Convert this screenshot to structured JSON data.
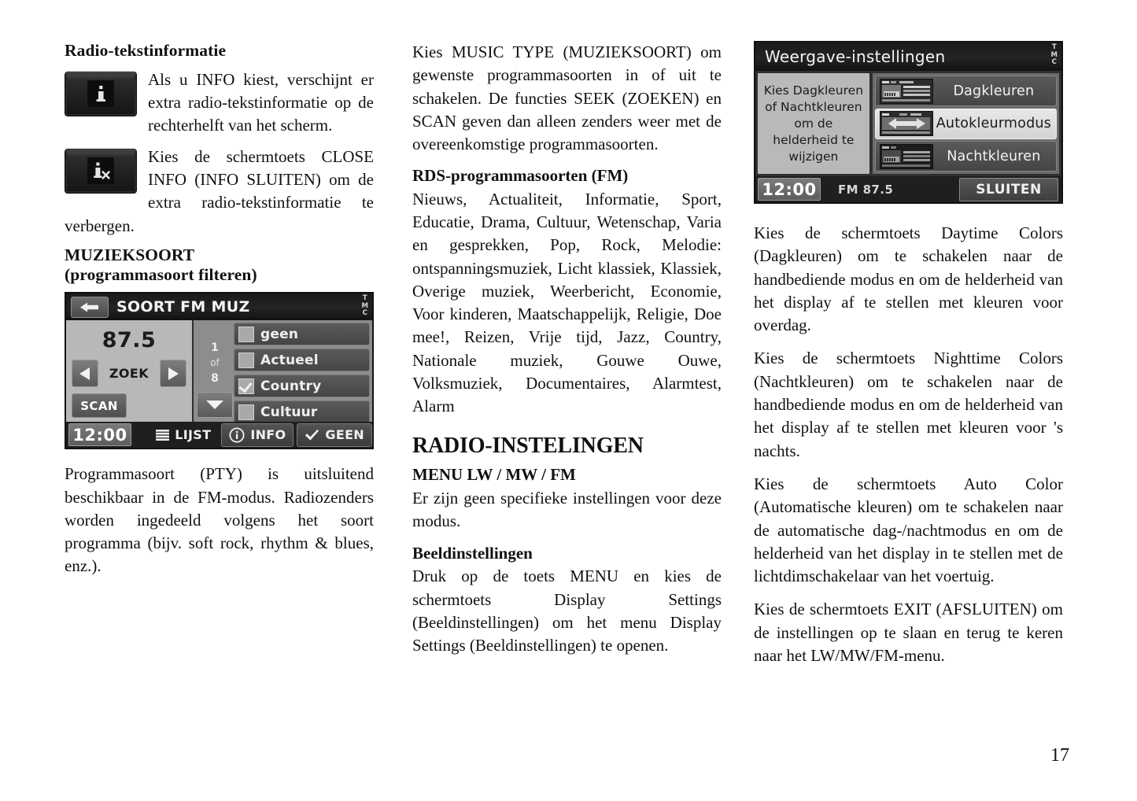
{
  "page": {
    "number": "17"
  },
  "left_column": {
    "heading_radiotext": "Radio-tekstinformatie",
    "para_info": "Als u INFO kiest, verschijnt er extra radio-tekstinformatie op de rechterhelft van het scherm.",
    "para_close_info": "Kies de schermtoets CLOSE INFO (INFO SLUITEN) om de extra radio-tekstinformatie te verbergen.",
    "icon_info_name": "info-icon",
    "icon_close_info_name": "close-info-icon",
    "heading_muzieksoort": "MUZIEKSOORT",
    "heading_muzieksoort_sub": "(programmasoort filteren)",
    "para_pty": "Programmasoort (PTY) is uitsluitend beschikbaar in de FM-modus. Radiozenders worden ingedeeld volgens het soort programma (bijv. soft rock, rhythm & blues, enz.)."
  },
  "display_pty": {
    "title": "SOORT FM MUZ",
    "tmc": [
      "T",
      "M",
      "C"
    ],
    "frequency": "87.5",
    "seek_label": "ZOEK",
    "scan_label": "SCAN",
    "pager": {
      "current": "1",
      "of": "of",
      "total": "8"
    },
    "list": [
      {
        "label": "geen",
        "checked": false
      },
      {
        "label": "Actueel",
        "checked": false
      },
      {
        "label": "Country",
        "checked": true
      },
      {
        "label": "Cultuur",
        "checked": false
      }
    ],
    "clock": "12:00",
    "softkeys": [
      {
        "label": "LIJST",
        "icon": "list-icon",
        "style": "plain"
      },
      {
        "label": "INFO",
        "icon": "info-circle-icon",
        "style": "raised"
      },
      {
        "label": "GEEN",
        "icon": "check-icon",
        "style": "raised"
      }
    ]
  },
  "middle_column": {
    "para_music_type": "Kies MUSIC TYPE (MUZIEKSOORT) om gewenste programmasoorten in of uit te schakelen. De functies SEEK (ZOEKEN) en SCAN geven dan alleen zenders weer met de overeenkomstige programmasoorten.",
    "heading_rds": "RDS-programmasoorten (FM)",
    "para_rds_list": "Nieuws, Actualiteit, Informatie, Sport, Educatie, Drama, Cultuur, Wetenschap, Varia en gesprekken, Pop, Rock, Melodie: ontspanningsmuziek, Licht klassiek, Klassiek, Overige muziek, Weerbericht, Economie, Voor kinderen, Maatschappelijk, Religie, Doe mee!, Reizen, Vrije tijd, Jazz, Country, Nationale muziek, Gouwe Ouwe, Volksmuziek, Documentaires, Alarmtest, Alarm",
    "heading_radio_instellingen": "RADIO-INSTELINGEN",
    "heading_menu": "MENU LW / MW / FM",
    "para_menu": "Er zijn geen specifieke instellingen voor deze modus.",
    "heading_beeld": "Beeldinstellingen",
    "para_beeld": "Druk op de toets MENU en kies de schermtoets Display Settings (Beeldinstellingen) om het menu Display Settings (Beeldinstellingen) te openen."
  },
  "display_settings": {
    "title": "Weergave-instellingen",
    "tmc": [
      "T",
      "M",
      "C"
    ],
    "note": "Kies Dagkleuren of Nachtkleuren om de helderheid te wijzigen",
    "options": [
      {
        "label": "Dagkleuren",
        "active": false,
        "icon": "day-colors-thumb-icon"
      },
      {
        "label": "Autokleurmodus",
        "active": true,
        "icon": "auto-color-thumb-icon"
      },
      {
        "label": "Nachtkleuren",
        "active": false,
        "icon": "night-colors-thumb-icon"
      }
    ],
    "clock": "12:00",
    "band_info": "FM 87.5",
    "exit_label": "SLUITEN"
  },
  "right_column": {
    "para_daytime": "Kies de schermtoets Daytime Colors (Dagkleuren) om te schakelen naar de handbediende modus en om de helderheid van het display af te stellen met kleuren voor overdag.",
    "para_nighttime": "Kies de schermtoets Nighttime Colors (Nachtkleuren) om te schakelen naar de handbediende modus en om de helderheid van het display af te stellen met kleuren voor 's nachts.",
    "para_autocolor": "Kies de schermtoets Auto Color (Automatische kleuren) om te schakelen naar de automatische dag-/nachtmodus en om de helderheid van het display in te stellen met de lichtdimschakelaar van het voertuig.",
    "para_exit": "Kies de schermtoets EXIT (AFSLUITEN) om de instellingen op te slaan en terug te keren naar het LW/MW/FM-menu."
  }
}
